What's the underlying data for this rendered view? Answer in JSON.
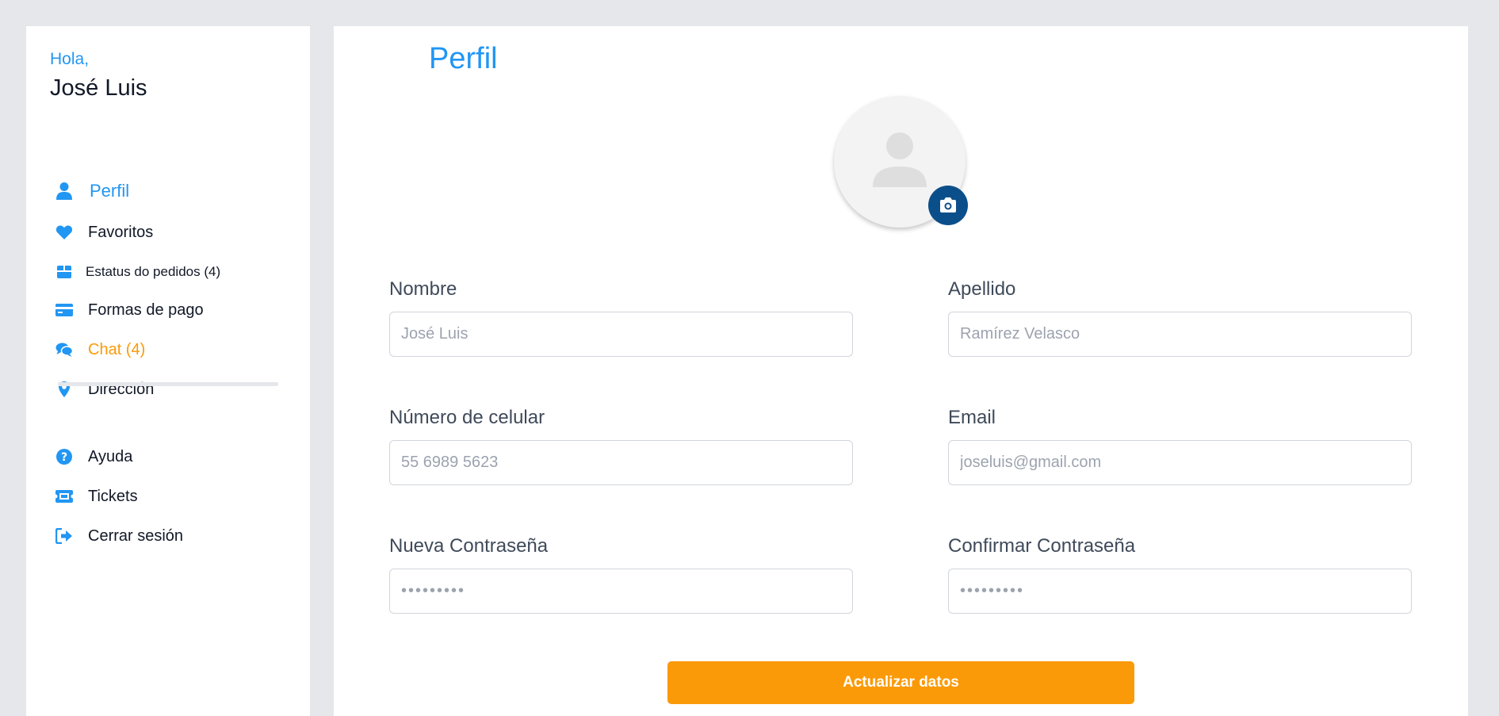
{
  "sidebar": {
    "greeting": "Hola,",
    "user_name": "José Luis",
    "items": [
      {
        "label": "Perfil",
        "icon": "user-icon"
      },
      {
        "label": "Favoritos",
        "icon": "heart-icon"
      },
      {
        "label": "Estatus do pedidos (4)",
        "icon": "box-icon"
      },
      {
        "label": "Formas de pago",
        "icon": "credit-card-icon"
      },
      {
        "label": "Chat (4)",
        "icon": "chat-icon"
      },
      {
        "label": "Dirección",
        "icon": "location-pin-icon"
      }
    ],
    "secondary_items": [
      {
        "label": "Ayuda",
        "icon": "help-icon"
      },
      {
        "label": "Tickets",
        "icon": "ticket-icon"
      },
      {
        "label": "Cerrar sesión",
        "icon": "logout-icon"
      }
    ]
  },
  "main": {
    "title": "Perfil",
    "fields": {
      "nombre": {
        "label": "Nombre",
        "placeholder": "José Luis"
      },
      "apellido": {
        "label": "Apellido",
        "placeholder": "Ramírez Velasco"
      },
      "celular": {
        "label": "Número de celular",
        "placeholder": "55 6989 5623"
      },
      "email": {
        "label": "Email",
        "placeholder": "joseluis@gmail.com"
      },
      "nueva_contrasena": {
        "label": "Nueva Contraseña",
        "placeholder": "•••••••••"
      },
      "confirmar_contrasena": {
        "label": "Confirmar Contraseña",
        "placeholder": "•••••••••"
      }
    },
    "submit_label": "Actualizar datos"
  },
  "colors": {
    "accent": "#2196f3",
    "orange": "#fb9a08",
    "camera_button": "#0b4f8a",
    "background": "#e5e7eb"
  }
}
